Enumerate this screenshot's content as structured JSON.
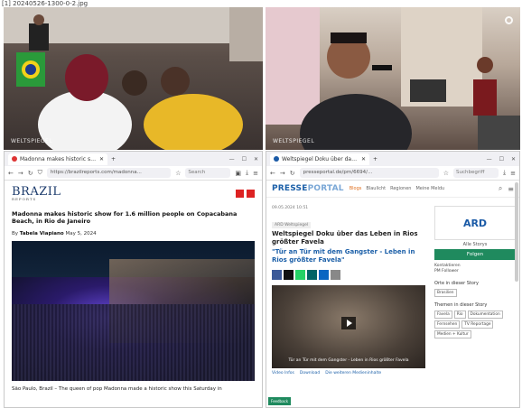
{
  "caption": "[1] 20240526-1300-0-2.jpg",
  "photos": {
    "left_watermark": "WELTSPIEGEL",
    "right_watermark": "WELTSPIEGEL"
  },
  "left_browser": {
    "tab_title": "Madonna makes historic show fo",
    "url": "https://brazilreports.com/madonna...",
    "search_placeholder": "Search",
    "site_logo": "BRAZIL",
    "site_logo_sub": "REPORTS",
    "headline": "Madonna makes historic show for 1.6 million people on Copacabana Beach, in Rio de Janeiro",
    "byline_prefix": "By",
    "author": "Tabela Viapiano",
    "date": "May 5, 2024",
    "body_start": "São Paulo, Brazil – The queen of pop Madonna made a historic show this Saturday in"
  },
  "right_browser": {
    "tab_title": "Weltspiegel Doku über das Leben i",
    "url": "presseportal.de/pm/6694/...",
    "search_placeholder": "Suchbegriff",
    "logo_a": "PRESSE",
    "logo_b": "PORTAL",
    "nav": [
      "Blogs",
      "Blaulicht",
      "Regionen",
      "Meine Meldu"
    ],
    "meta": "09.05.2024 10:51",
    "tag": "ARD Weltspiegel",
    "headline": "Weltspiegel Doku über das Leben in Rios größter Favela",
    "subheadline": "\"Tür an Tür mit dem Gangster - Leben in Rios größter Favela\"",
    "video_caption": "Tür an Tür mit dem Gangster - Leben in Rios größter Favela",
    "video_links": [
      "Video Infos",
      "Download",
      "Die weiteren Medieninhalte"
    ],
    "ard_logo": "ARD",
    "ard_name": "Alle Storys",
    "follow_label": "Folgen",
    "side_info": [
      "Kontaktieren",
      "PM Follower"
    ],
    "side_h1": "Orte in dieser Story",
    "place_chip": "Brasilien",
    "side_h2": "Themen in dieser Story",
    "topic_chips": [
      "Favela",
      "Rio",
      "Dokumentation",
      "Fernsehen",
      "TV Reportage",
      "Medien + Kultur"
    ],
    "feedback_label": "Feedback"
  }
}
